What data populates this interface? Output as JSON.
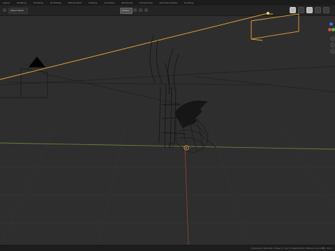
{
  "app": {
    "name": "Blender"
  },
  "topbar": {
    "tabs": [
      {
        "label": "Layout"
      },
      {
        "label": "Modeling"
      },
      {
        "label": "Sculpting"
      },
      {
        "label": "UV Editing"
      },
      {
        "label": "Texture Paint"
      },
      {
        "label": "Shading"
      },
      {
        "label": "Animation"
      },
      {
        "label": "Rendering"
      },
      {
        "label": "Compositing"
      },
      {
        "label": "Geometry Nodes"
      },
      {
        "label": "Scripting"
      }
    ]
  },
  "subbar": {
    "mode_label": "Object Mode",
    "transform_label": "Global"
  },
  "status": {
    "text": "Character | Verts 26 | Faces 2 | Tris 4 | Objects 0/3 | Memory 121.9 MB | 3.6.1"
  },
  "colors": {
    "viewport_bg": "#2e2e2e",
    "selection_orange": "#e8a33a",
    "axis_x": "#a3463f",
    "axis_y": "#7da53f",
    "gizmo_blue": "#3a6fd8",
    "gizmo_red": "#d84a4a",
    "gizmo_green": "#5fb24a"
  },
  "icons": {
    "camera_icon": "triangle-camera",
    "pivot_icon": "circle-pivot"
  }
}
